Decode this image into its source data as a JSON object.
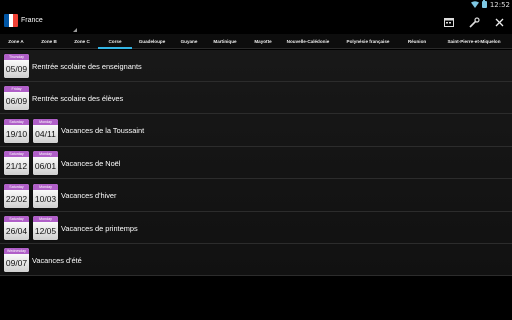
{
  "status_bar": {
    "time": "12:52",
    "icons": [
      "wifi-icon",
      "battery-icon"
    ]
  },
  "action_bar": {
    "country": "France",
    "flag_colors": [
      "#0055a4",
      "#ffffff",
      "#ef4135"
    ],
    "actions": [
      {
        "name": "calendar-export-icon",
        "glyph": "▦"
      },
      {
        "name": "settings-tools-icon",
        "glyph": "⚒"
      },
      {
        "name": "close-icon",
        "glyph": "✕"
      }
    ]
  },
  "tabs": [
    {
      "label": "Zone A"
    },
    {
      "label": "Zone B"
    },
    {
      "label": "Zone C"
    },
    {
      "label": "Corse"
    },
    {
      "label": "Guadeloupe"
    },
    {
      "label": "Guyane"
    },
    {
      "label": "Martinique"
    },
    {
      "label": "Mayotte"
    },
    {
      "label": "Nouvelle-Calédonie"
    },
    {
      "label": "Polynésie française"
    },
    {
      "label": "Réunion"
    },
    {
      "label": "Saint-Pierre-et-Miquelon"
    }
  ],
  "active_tab": "Corse",
  "accent_color": "#33b5e5",
  "calendar_header_color": "#b05fc8",
  "events": [
    {
      "label": "Rentrée scolaire des enseignants",
      "start": {
        "day": "Thursday",
        "date": "05/09"
      }
    },
    {
      "label": "Rentrée scolaire des élèves",
      "start": {
        "day": "Friday",
        "date": "06/09"
      }
    },
    {
      "label": "Vacances de la Toussaint",
      "start": {
        "day": "Saturday",
        "date": "19/10"
      },
      "end": {
        "day": "Monday",
        "date": "04/11"
      }
    },
    {
      "label": "Vacances de Noël",
      "start": {
        "day": "Saturday",
        "date": "21/12"
      },
      "end": {
        "day": "Monday",
        "date": "06/01"
      }
    },
    {
      "label": "Vacances d'hiver",
      "start": {
        "day": "Saturday",
        "date": "22/02"
      },
      "end": {
        "day": "Monday",
        "date": "10/03"
      }
    },
    {
      "label": "Vacances de printemps",
      "start": {
        "day": "Saturday",
        "date": "26/04"
      },
      "end": {
        "day": "Monday",
        "date": "12/05"
      }
    },
    {
      "label": "Vacances d'été",
      "start": {
        "day": "Wednesday",
        "date": "09/07"
      }
    }
  ]
}
